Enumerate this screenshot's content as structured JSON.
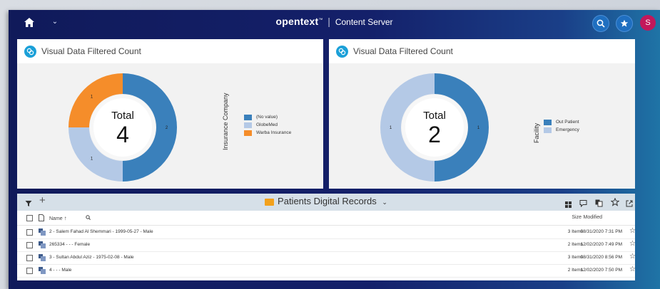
{
  "header": {
    "brand_logo": "opentext",
    "brand_mark": "™",
    "brand_separator": "|",
    "product_name": "Content Server",
    "user_initial": "S",
    "icons": [
      "home-icon",
      "chevron-down-icon",
      "search-icon",
      "star-icon",
      "user-avatar"
    ]
  },
  "colors": {
    "brand_blue": "#14206a",
    "donut_primary": "#3a80bb",
    "donut_light": "#b4c9e6",
    "donut_orange": "#f58d2a",
    "avatar": "#c2185b"
  },
  "widgets": [
    {
      "title": "Visual Data Filtered Count",
      "total_label": "Total",
      "total_value": "4",
      "legend_title": "Insurance Company",
      "chart_data": {
        "type": "pie",
        "donut": true,
        "categories": [
          "(No value)",
          "GlobeMed",
          "Warba Insurance"
        ],
        "values": [
          2,
          1,
          1
        ],
        "colors": [
          "#3a80bb",
          "#b4c9e6",
          "#f58d2a"
        ]
      }
    },
    {
      "title": "Visual Data Filtered Count",
      "total_label": "Total",
      "total_value": "2",
      "legend_title": "Facility",
      "chart_data": {
        "type": "pie",
        "donut": true,
        "categories": [
          "Out Patient",
          "Emergency"
        ],
        "values": [
          1,
          1
        ],
        "colors": [
          "#3a80bb",
          "#b4c9e6"
        ]
      }
    }
  ],
  "list": {
    "folder_name": "Patients Digital Records",
    "columns": {
      "name": "Name",
      "size": "Size",
      "modified": "Modified"
    },
    "rows": [
      {
        "name": "2 - Salem Fahad Al Shemmari - 1999-05-27 - Male",
        "size": "3 Items",
        "modified": "08/31/2020 7:31 PM"
      },
      {
        "name": "265334 - - - Female",
        "size": "2 Items",
        "modified": "12/02/2020 7:49 PM"
      },
      {
        "name": "3 - Sultan Abdul Aziz - 1975-02-08 - Male",
        "size": "3 Items",
        "modified": "08/31/2020 8:56 PM"
      },
      {
        "name": "4 - - - Male",
        "size": "2 Items",
        "modified": "12/02/2020 7:50 PM"
      }
    ]
  }
}
